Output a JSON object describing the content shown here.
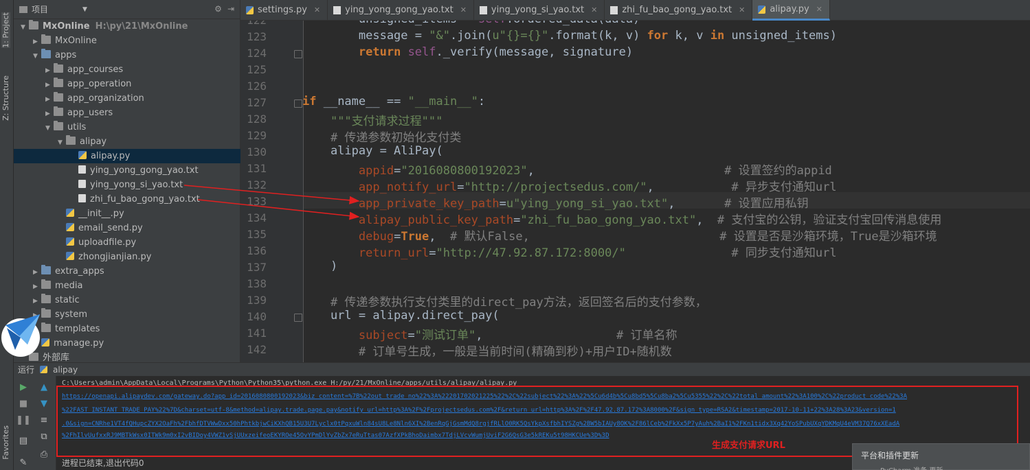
{
  "project_panel": {
    "title": "项目",
    "tree": [
      {
        "label": "MxOnline",
        "path": "H:\\py\\21\\MxOnline",
        "depth": 0,
        "kind": "folder",
        "open": true
      },
      {
        "label": "MxOnline",
        "depth": 1,
        "kind": "folder",
        "open": false
      },
      {
        "label": "apps",
        "depth": 1,
        "kind": "folder-blue",
        "open": true
      },
      {
        "label": "app_courses",
        "depth": 2,
        "kind": "folder",
        "open": false
      },
      {
        "label": "app_operation",
        "depth": 2,
        "kind": "folder",
        "open": false
      },
      {
        "label": "app_organization",
        "depth": 2,
        "kind": "folder",
        "open": false
      },
      {
        "label": "app_users",
        "depth": 2,
        "kind": "folder",
        "open": false
      },
      {
        "label": "utils",
        "depth": 2,
        "kind": "folder",
        "open": true
      },
      {
        "label": "alipay",
        "depth": 3,
        "kind": "folder",
        "open": true
      },
      {
        "label": "alipay.py",
        "depth": 4,
        "kind": "py",
        "selected": true
      },
      {
        "label": "ying_yong_gong_yao.txt",
        "depth": 4,
        "kind": "txt"
      },
      {
        "label": "ying_yong_si_yao.txt",
        "depth": 4,
        "kind": "txt"
      },
      {
        "label": "zhi_fu_bao_gong_yao.txt",
        "depth": 4,
        "kind": "txt"
      },
      {
        "label": "__init__.py",
        "depth": 3,
        "kind": "py"
      },
      {
        "label": "email_send.py",
        "depth": 3,
        "kind": "py"
      },
      {
        "label": "uploadfile.py",
        "depth": 3,
        "kind": "py"
      },
      {
        "label": "zhongjianjian.py",
        "depth": 3,
        "kind": "py"
      },
      {
        "label": "extra_apps",
        "depth": 1,
        "kind": "folder-blue",
        "open": false
      },
      {
        "label": "media",
        "depth": 1,
        "kind": "folder",
        "open": false
      },
      {
        "label": "static",
        "depth": 1,
        "kind": "folder",
        "open": false
      },
      {
        "label": "system",
        "depth": 1,
        "kind": "folder",
        "open": false
      },
      {
        "label": "templates",
        "depth": 1,
        "kind": "folder",
        "open": false
      },
      {
        "label": "manage.py",
        "depth": 1,
        "kind": "py"
      },
      {
        "label": "外部库",
        "depth": 0,
        "kind": "lib"
      }
    ]
  },
  "left_strip": {
    "tab_project": "1: Project",
    "tab_structure": "Z: Structure",
    "tab_favorites": "Favorites"
  },
  "editor_tabs": [
    {
      "label": "settings.py",
      "active": false
    },
    {
      "label": "ying_yong_gong_yao.txt",
      "active": false
    },
    {
      "label": "ying_yong_si_yao.txt",
      "active": false
    },
    {
      "label": "zhi_fu_bao_gong_yao.txt",
      "active": false
    },
    {
      "label": "alipay.py",
      "active": true
    }
  ],
  "code_lines": [
    {
      "num": "122",
      "html": "        unsigned_items = <span class='selfc'>self</span>.ordered_data(data)"
    },
    {
      "num": "123",
      "html": "        message = <span class='str'>\"&amp;\"</span>.join(<span class='str'>u\"{}={}\"</span>.format(k, v) <span class='kw'>for</span> k, v <span class='kw'>in</span> unsigned_items)"
    },
    {
      "num": "124",
      "html": "        <span class='kw'>return</span> <span class='selfc'>self</span>._verify(message, signature)"
    },
    {
      "num": "125",
      "html": ""
    },
    {
      "num": "126",
      "html": ""
    },
    {
      "num": "127",
      "html": "<span class='kw'>if</span> __name__ == <span class='str'>\"__main__\"</span>:"
    },
    {
      "num": "128",
      "html": "    <span class='str'>\"\"\"支付请求过程\"\"\"</span>"
    },
    {
      "num": "129",
      "html": "    <span class='cmt'># 传递参数初始化支付类</span>"
    },
    {
      "num": "130",
      "html": "    alipay = AliPay("
    },
    {
      "num": "131",
      "html": "        <span class='param'>appid</span>=<span class='str'>\"2016080800192023\"</span>,                           <span class='cmt'># 设置签约的appid</span>"
    },
    {
      "num": "132",
      "html": "        <span class='param'>app_notify_url</span>=<span class='str'>\"http://projectsedus.com/\"</span>,           <span class='cmt'># 异步支付通知url</span>"
    },
    {
      "num": "133",
      "html": "        <span class='param'>app_private_key_path</span>=<span class='str'>u\"ying_yong_si_yao.txt\"</span>,       <span class='cmt'># 设置应用私钥</span>"
    },
    {
      "num": "134",
      "html": "        <span class='param'>alipay_public_key_path</span>=<span class='str'>\"zhi_fu_bao_gong_yao.txt\"</span>,  <span class='cmt'># 支付宝的公钥，验证支付宝回传消息使用</span>"
    },
    {
      "num": "135",
      "html": "        <span class='param'>debug</span>=<span class='kw'>True</span>,  <span class='cmt'># 默认False,</span>                           <span class='cmt'># 设置是否是沙箱环境，True是沙箱环境</span>"
    },
    {
      "num": "136",
      "html": "        <span class='param'>return_url</span>=<span class='str'>\"http://47.92.87.172:8000/\"</span>               <span class='cmt'># 同步支付通知url</span>"
    },
    {
      "num": "137",
      "html": "    )"
    },
    {
      "num": "138",
      "html": ""
    },
    {
      "num": "139",
      "html": "    <span class='cmt'># 传递参数执行支付类里的direct_pay方法，返回签名后的支付参数，</span>"
    },
    {
      "num": "140",
      "html": "    url = alipay.direct_pay("
    },
    {
      "num": "141",
      "html": "        <span class='param'>subject</span>=<span class='str'>\"测试订单\"</span>,                   <span class='cmt'># 订单名称</span>"
    },
    {
      "num": "142",
      "html": "        <span class='cmt'># 订单号生成，一般是当前时间(精确到秒)+用户ID+随机数</span>"
    }
  ],
  "run_panel": {
    "header_label": "运行",
    "config_name": "alipay",
    "command_line": "C:\\Users\\admin\\AppData\\Local\\Programs\\Python\\Python35\\python.exe H:/py/21/MxOnline/apps/utils/alipay/alipay.py",
    "url_lines": [
      "https://openapi.alipaydev.com/gateway.do?app_id=2016080800192023&biz_content=%7B%22out_trade_no%22%3A%22201702021225%22%2C%22subject%22%3A%22%5Cu6d4b%5Cu8bd5%5Cu8ba2%5Cu5355%22%2C%22total_amount%22%3A100%2C%22product_code%22%3A",
      "%22FAST_INSTANT_TRADE_PAY%22%7D&charset=utf-8&method=alipay.trade.page.pay&notify_url=http%3A%2F%2Fprojectsedus.com%2F&return_url=http%3A%2F%2F47.92.87.172%3A8000%2F&sign_type=RSA2&timestamp=2017-10-11+22%3A28%3A23&version=1",
      ".0&sign=CNRhe1VT4fQHupcZYX2OaFh%2FbhfDTVWwDxx50hPhtkbjwCiKXhQB15U3U7Lyclx0tPqxuWln84sU8Le8Nln6XI%2BenRqGjGsmMdQ8rgjfRLlO0RK5QsYkpXsfbhIYSZg%2BW5bIAUy8OK%2F86lCeb%2FkXx5P7yAuh%2BaI1%2FKn1tidx3Xq42YoSPubUXqYDKMqU4eVM37Q76xXEadA",
      "%2FhIlvUufxxRJ9MBTkWsx0ITWk9m0xI2vBIDoy4VWZ1vSjUUxzeifeoEKYROe45OvYPmDlYvZbZx7eRuTtas07AzfXPkBhoDaimbx7TdjLVcvWumjUviF2G6QsG3e5kREKu5t98HKCUe%3D%3D"
    ],
    "annotation": "生成支付请求URL",
    "exit_text": "进程已结束,退出代码0"
  },
  "notification": {
    "title": "平台和插件更新",
    "subtitle": "PyCharm 准备 更新"
  },
  "colors": {
    "annotation_red": "#e02020",
    "link_blue": "#287bde",
    "ide_bg": "#2b2b2b",
    "panel_bg": "#3c3f41"
  }
}
